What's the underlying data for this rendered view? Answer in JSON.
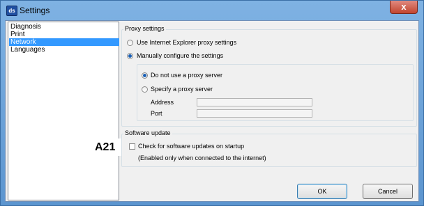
{
  "window": {
    "title": "Settings",
    "app_icon": "ds",
    "close_glyph": "x"
  },
  "nav": {
    "items": [
      {
        "label": "Diagnosis",
        "selected": false
      },
      {
        "label": "Print",
        "selected": false
      },
      {
        "label": "Network",
        "selected": true
      },
      {
        "label": "Languages",
        "selected": false
      }
    ]
  },
  "proxy": {
    "group_label": "Proxy settings",
    "use_ie": "Use Internet Explorer proxy settings",
    "manual": "Manually configure the settings",
    "no_proxy": "Do not use a proxy server",
    "specify": "Specify a proxy server",
    "address_label": "Address",
    "port_label": "Port",
    "address_value": "",
    "port_value": "",
    "selected_mode": "manual",
    "manual_choice": "no_proxy"
  },
  "software_update": {
    "group_label": "Software update",
    "check_label": "Check for software updates on startup",
    "note": "(Enabled only when connected to the internet)",
    "checked": false
  },
  "buttons": {
    "ok": "OK",
    "cancel": "Cancel"
  },
  "callout": {
    "label": "A21"
  },
  "colors": {
    "selection": "#3399ff",
    "titlebar": "#7fb2e3",
    "close": "#c2452f"
  }
}
